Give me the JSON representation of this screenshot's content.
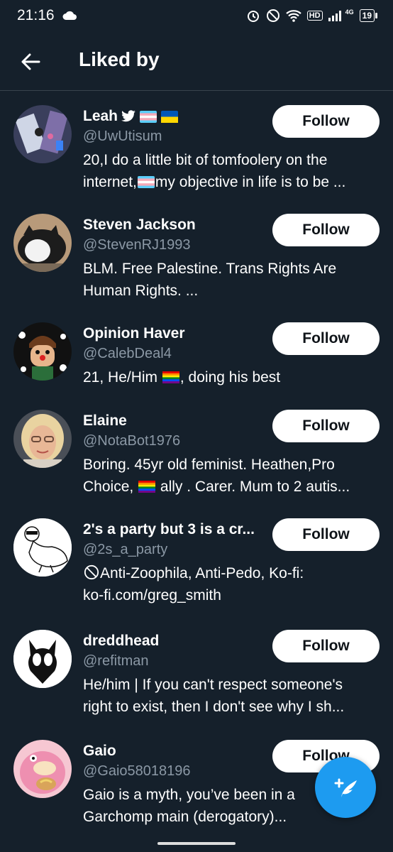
{
  "status_bar": {
    "time": "21:16",
    "hd": "HD",
    "network": "4G",
    "battery": "19"
  },
  "header": {
    "title": "Liked by"
  },
  "follow_label": "Follow",
  "users": [
    {
      "name": "Leah",
      "handle": "@UwUtisum",
      "bio": [
        "20,I do a little bit of tomfoolery on the",
        "internet,",
        "my objective in life is to be ..."
      ]
    },
    {
      "name": "Steven Jackson",
      "handle": "@StevenRJ1993",
      "bio": [
        "BLM. Free Palestine. Trans Rights Are",
        "Human Rights. ..."
      ]
    },
    {
      "name": "Opinion Haver",
      "handle": "@CalebDeal4",
      "bio": [
        "21, He/Him",
        ", doing his best"
      ]
    },
    {
      "name": "Elaine",
      "handle": "@NotaBot1976",
      "bio": [
        "Boring. 45yr old feminist. Heathen,Pro",
        "Choice,",
        "ally . Carer. Mum to 2 autis..."
      ]
    },
    {
      "name": "2's a party but 3 is a cr...",
      "handle": "@2s_a_party",
      "bio": [
        "Anti-Zoophila, Anti-Pedo, Ko-fi:",
        "ko-fi.com/greg_smith"
      ]
    },
    {
      "name": "dreddhead",
      "handle": "@refitman",
      "bio": [
        "He/him | If you can't respect someone's",
        "right to exist, then I don't see why I sh..."
      ]
    },
    {
      "name": "Gaio",
      "handle": "@Gaio58018196",
      "bio": [
        "Gaio is a myth, you’ve been in a",
        "Garchomp main (derogatory)..."
      ]
    }
  ],
  "colors": {
    "background": "#15202b",
    "handle": "#8b98a5",
    "accent": "#1d9bf0",
    "divider": "#38444d"
  },
  "icons": {
    "back": "arrow-left-icon",
    "verified": "bird-icon",
    "compose": "compose-tweet-icon"
  }
}
